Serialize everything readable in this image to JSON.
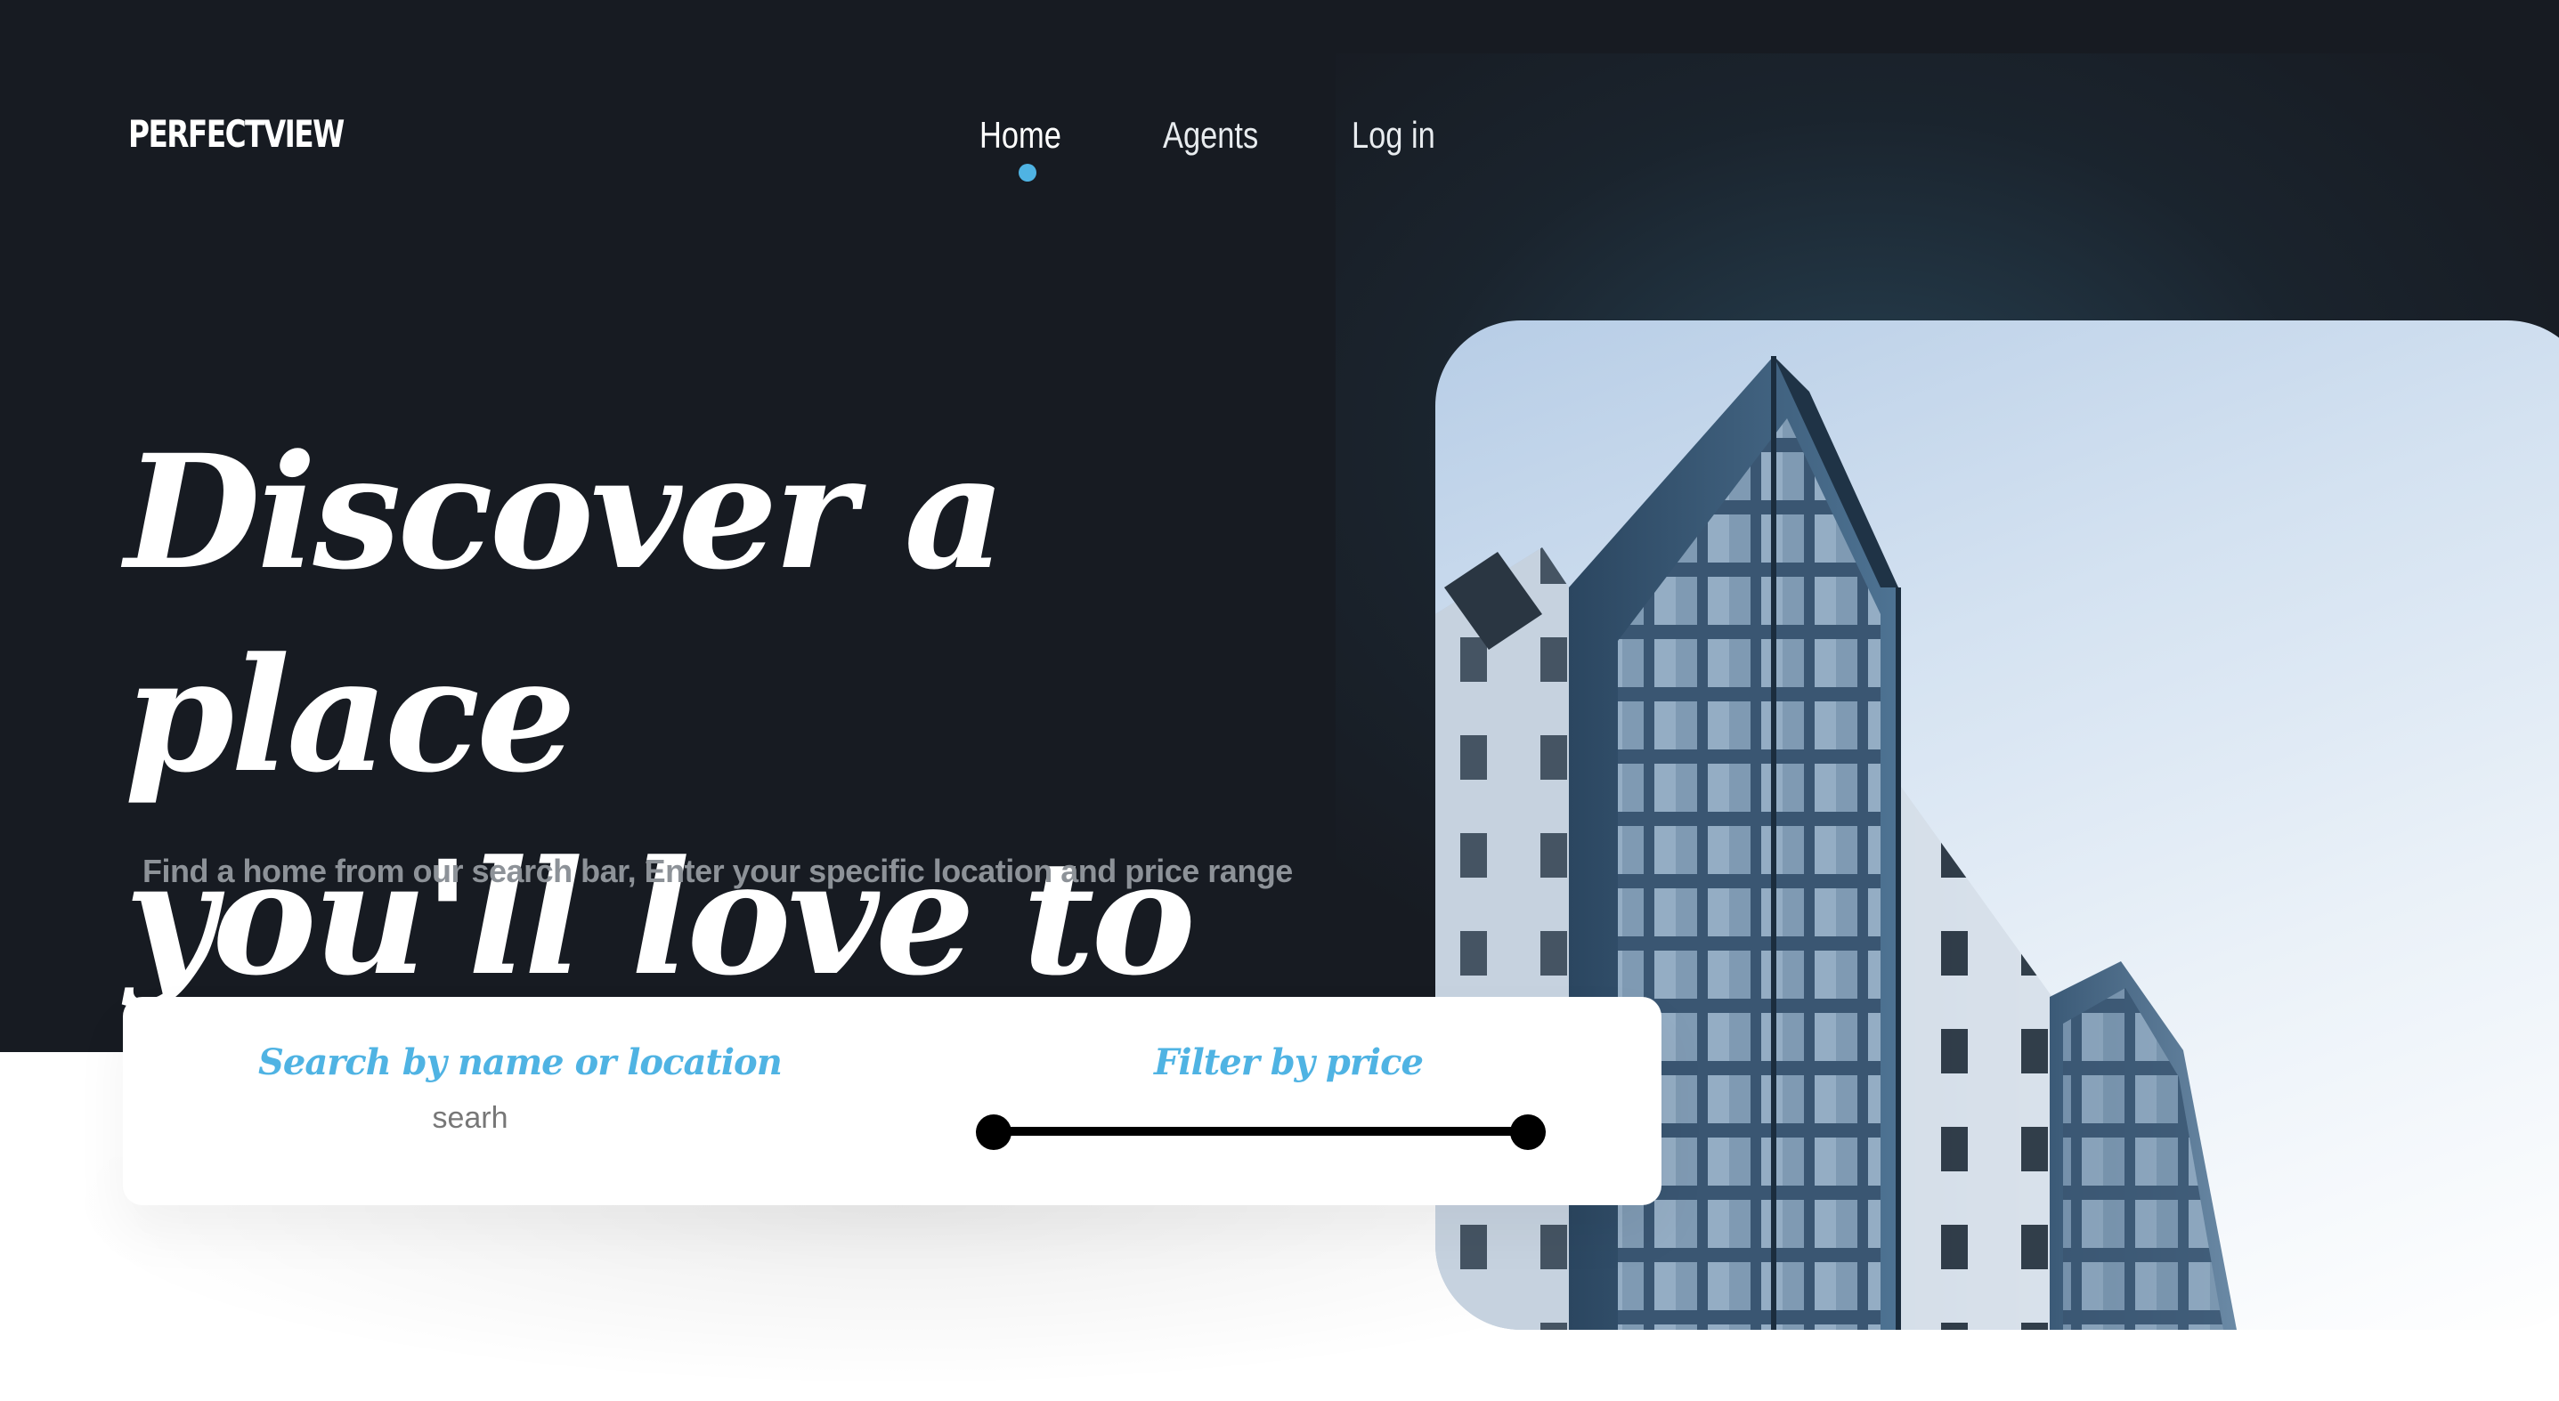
{
  "header": {
    "logo": "PERFECTVIEW",
    "nav": [
      {
        "label": "Home",
        "active": true
      },
      {
        "label": "Agents",
        "active": false
      },
      {
        "label": "Log in",
        "active": false
      }
    ]
  },
  "hero": {
    "headline_line1": "Discover a place",
    "headline_line2": "you'll love to live",
    "subtitle": "Find a home from our search bar, Enter your specific location and price range"
  },
  "search": {
    "name_label": "Search by name or location",
    "input_value": "searh",
    "price_label": "Filter by price",
    "price_range": {
      "min": 0,
      "max": 1
    }
  },
  "colors": {
    "background_dark": "#171b22",
    "accent": "#4fb3e3",
    "text_light": "#ffffff",
    "text_muted": "#8d9298"
  },
  "icons": {
    "nav_active_indicator": "dot"
  }
}
